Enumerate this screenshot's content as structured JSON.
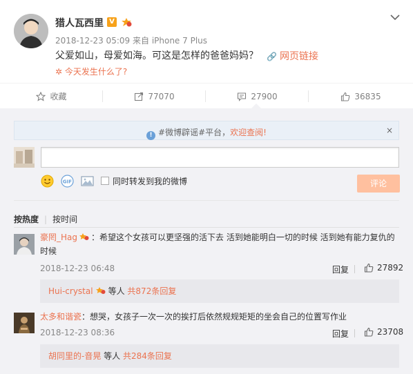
{
  "post": {
    "author": "猎人瓦西里",
    "verified_badge": "V",
    "timestamp": "2018-12-23 05:09",
    "source_prefix": "来自",
    "source": "iPhone 7 Plus",
    "text": "父爱如山，母爱如海。可这是怎样的爸爸妈妈？",
    "link_text": "网页链接",
    "topic_text": "今天发生什么了?",
    "icons": [
      "avatar",
      "vip-badge",
      "level-badge",
      "chevron-down-icon",
      "link-icon",
      "sparkle-icon"
    ]
  },
  "actions": {
    "favorite": "收藏",
    "repost_count": "77070",
    "comment_count": "27900",
    "like_count": "36835"
  },
  "notice": {
    "prefix": "#微博辟谣#平台，",
    "highlight": "欢迎查阅!",
    "close": "×"
  },
  "composer": {
    "input_value": "",
    "repost_checkbox_label": "同时转发到我的微博",
    "submit_label": "评论"
  },
  "sort": {
    "by_heat": "按热度",
    "separator": "|",
    "by_time": "按时间"
  },
  "comments": [
    {
      "user": "豪罔_Hag",
      "text": "：希望这个女孩可以更坚强的活下去 活到她能明白一切的时候 活到她有能力复仇的时候",
      "time": "2018-12-23 06:48",
      "reply_label": "回复",
      "likes": "27892",
      "sub_user": "Hui-crystal",
      "sub_mid": "等人",
      "sub_count": "共872条回复"
    },
    {
      "user": "太多和谐瓷",
      "text": "：想哭，女孩子一次一次的挨打后依然规规矩矩的坐会自己的位置写作业",
      "time": "2018-12-23 08:36",
      "reply_label": "回复",
      "likes": "23708",
      "sub_user": "胡同里的-音晃",
      "sub_mid": "等人",
      "sub_count": "共284条回复"
    }
  ],
  "colors": {
    "accent": "#eb7350",
    "panel": "#f2f2f5",
    "submit_disabled": "#ffc09f",
    "notice_bg": "#eaf0f7"
  }
}
